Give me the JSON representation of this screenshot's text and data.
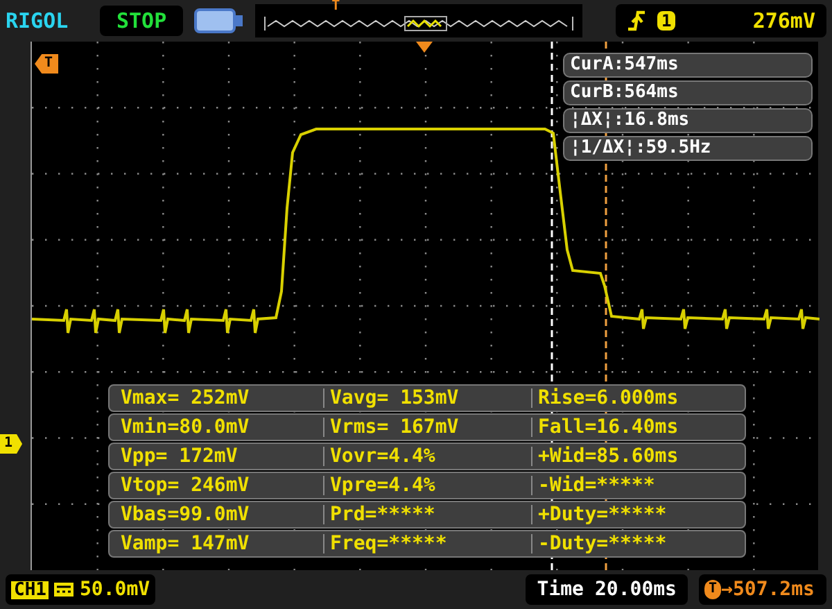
{
  "brand": "RIGOL",
  "run_state": "STOP",
  "overview_marker": "T",
  "trigger": {
    "channel": "1",
    "level": "276mV"
  },
  "grid_markers": {
    "trigger": "T",
    "channel": "1"
  },
  "cursors": [
    "CurA:547ms",
    "CurB:564ms",
    "¦ΔX¦:16.8ms",
    "¦1/ΔX¦:59.5Hz"
  ],
  "measurements": [
    [
      "Vmax= 252mV",
      "Vavg= 153mV",
      "Rise=6.000ms"
    ],
    [
      "Vmin=80.0mV",
      "Vrms= 167mV",
      "Fall=16.40ms"
    ],
    [
      "Vpp= 172mV",
      "Vovr=4.4%",
      "+Wid=85.60ms"
    ],
    [
      "Vtop= 246mV",
      "Vpre=4.4%",
      "-Wid=*****"
    ],
    [
      "Vbas=99.0mV",
      "Prd=*****",
      "+Duty=*****"
    ],
    [
      "Vamp= 147mV",
      "Freq=*****",
      "-Duty=*****"
    ]
  ],
  "status": {
    "channel": "CH1",
    "scale": "50.0mV",
    "time_label": "Time",
    "timebase": "20.00ms",
    "offset_badge": "T",
    "offset": "→507.2ms"
  }
}
